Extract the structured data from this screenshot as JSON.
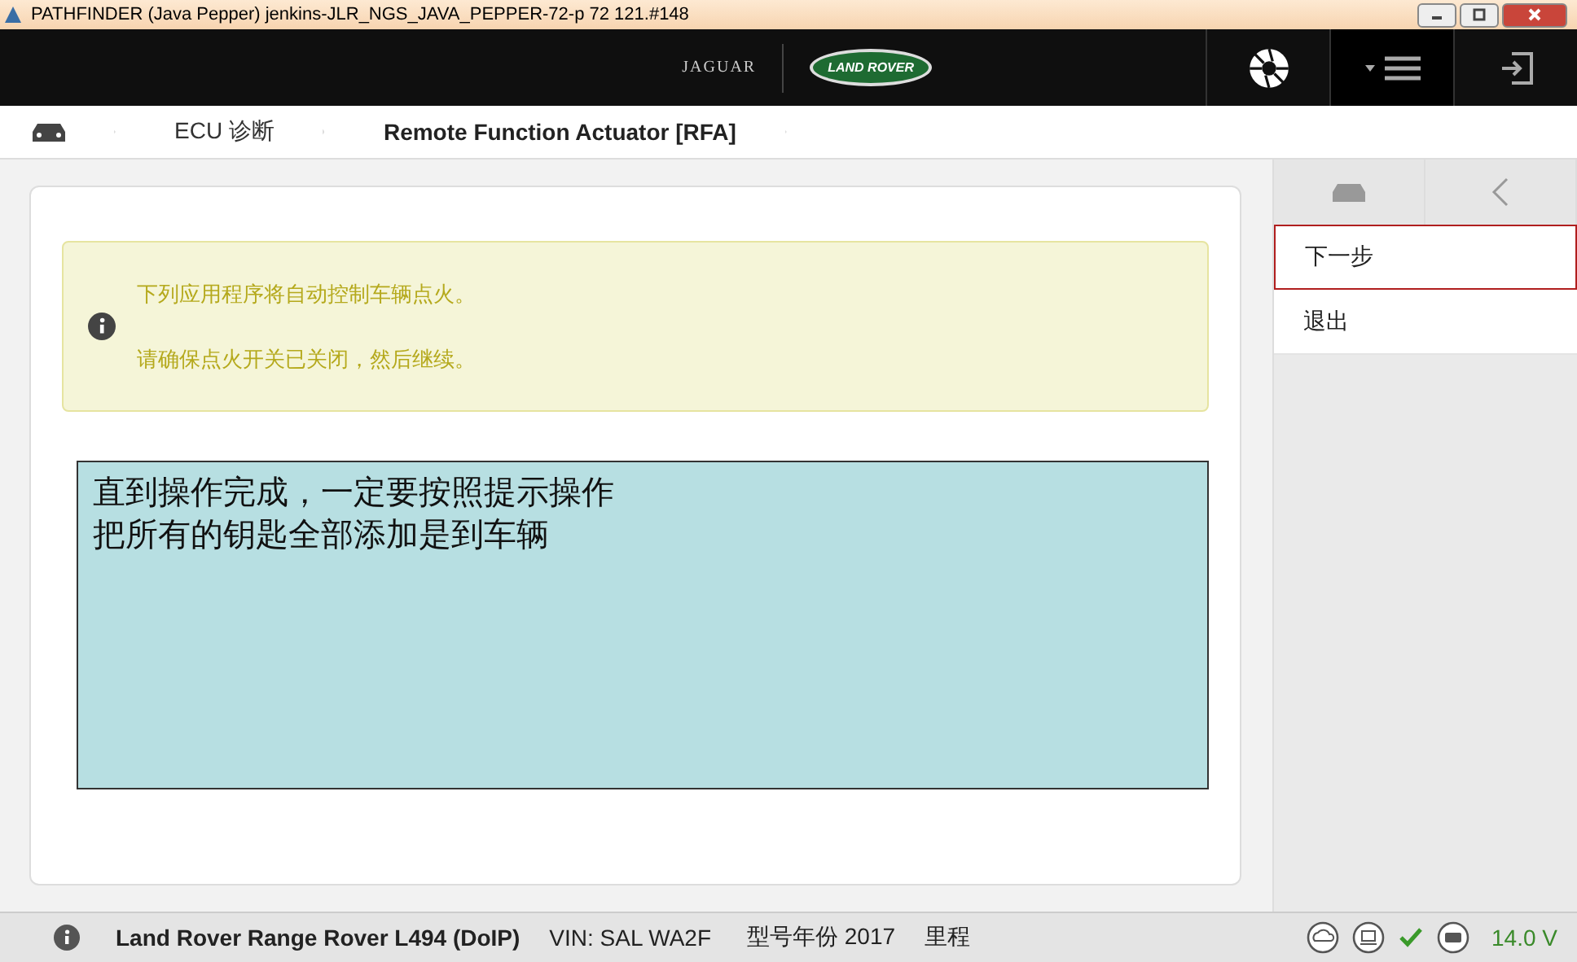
{
  "window": {
    "title": "PATHFINDER (Java Pepper) jenkins-JLR_NGS_JAVA_PEPPER-72-p 72 121.#148"
  },
  "header": {
    "logos": [
      "JAGUAR",
      "LAND ROVER"
    ]
  },
  "breadcrumb": [
    "ECU 诊断",
    "Remote Function Actuator [RFA]"
  ],
  "notice": {
    "lines": [
      "下列应用程序将自动控制车辆点火。",
      "请确保点火开关已关闭，然后继续。"
    ]
  },
  "note": {
    "lines": [
      "直到操作完成，一定要按照提示操作",
      "把所有的钥匙全部添加是到车辆"
    ]
  },
  "sidebar": {
    "items": [
      {
        "label": "下一步",
        "selected": true
      },
      {
        "label": "退出",
        "selected": false
      }
    ]
  },
  "status_bar": {
    "vehicle": "Land Rover Range Rover L494 (DoIP)",
    "vin": "VIN: SAL WA2F",
    "model_year": "型号年份 2017",
    "mileage": "里程",
    "voltage": "14.0 V"
  }
}
